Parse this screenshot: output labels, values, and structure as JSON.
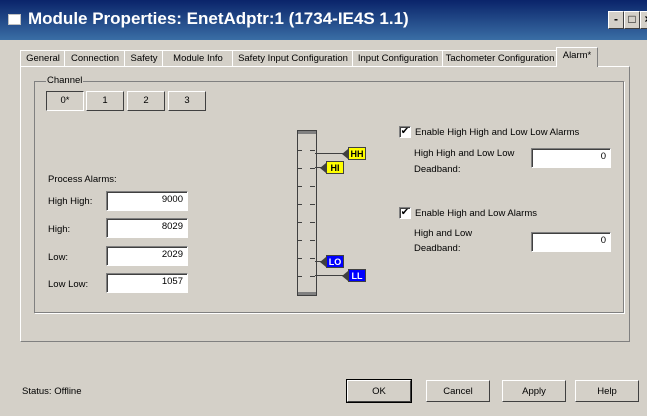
{
  "window": {
    "title": "Module Properties: EnetAdptr:1 (1734-IE4S 1.1)",
    "btn_min": "-",
    "btn_max": "□",
    "btn_close": "×"
  },
  "tabs": [
    {
      "label": "General"
    },
    {
      "label": "Connection"
    },
    {
      "label": "Safety"
    },
    {
      "label": "Module Info"
    },
    {
      "label": "Safety Input Configuration"
    },
    {
      "label": "Input Configuration"
    },
    {
      "label": "Tachometer Configuration"
    },
    {
      "label": "Alarm*",
      "active": true
    }
  ],
  "channel": {
    "group_label": "Channel",
    "buttons": [
      "0*",
      "1",
      "2",
      "3"
    ],
    "selected": "0*"
  },
  "process_alarms": {
    "heading": "Process Alarms:",
    "high_high_label": "High High:",
    "high_high_value": "9000",
    "high_label": "High:",
    "high_value": "8029",
    "low_label": "Low:",
    "low_value": "2029",
    "low_low_label": "Low Low:",
    "low_low_value": "1057"
  },
  "gauge": {
    "hh_marker": "HH",
    "hi_marker": "HI",
    "lo_marker": "LO",
    "ll_marker": "LL",
    "hh_color": "#ffff00",
    "ll_color": "#0000ff"
  },
  "hh_ll_alarms": {
    "enabled": true,
    "check_mark": "✔",
    "label": "Enable High  High and Low Low Alarms",
    "deadband_label_1": "High High and Low Low",
    "deadband_label_2": "Deadband:",
    "deadband_value": "0"
  },
  "hi_lo_alarms": {
    "enabled": true,
    "check_mark": "✔",
    "label": "Enable High and Low Alarms",
    "deadband_label_1": "High and Low",
    "deadband_label_2": "Deadband:",
    "deadband_value": "0"
  },
  "footer": {
    "status": "Status:  Offline",
    "ok": "OK",
    "cancel": "Cancel",
    "apply": "Apply",
    "help": "Help"
  }
}
